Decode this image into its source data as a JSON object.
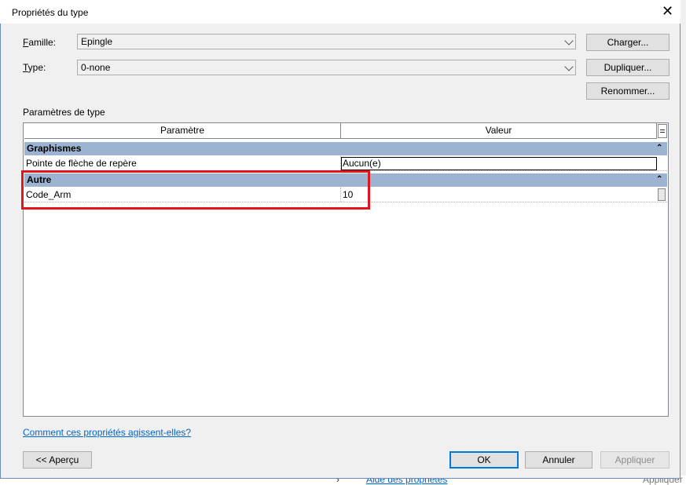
{
  "window": {
    "title": "Propriétés du type",
    "close_label": "✕"
  },
  "famille": {
    "label_prefix": "F",
    "label_rest": "amille:",
    "value": "Epingle"
  },
  "type": {
    "label_prefix": "T",
    "label_rest": "ype:",
    "value": "0-none"
  },
  "buttons": {
    "charger": "Charger...",
    "dupliquer": "Dupliquer...",
    "renommer": "Renommer...",
    "apercu": "<< Aperçu",
    "ok": "OK",
    "annuler": "Annuler",
    "appliquer": "Appliquer"
  },
  "section_label": "Paramètres de type",
  "table": {
    "columns": [
      "Paramètre",
      "Valeur"
    ],
    "collapse_all": "=",
    "groups": [
      {
        "name": "Graphismes",
        "collapse_icon": "⌃",
        "rows": [
          {
            "param": "Pointe de flèche de repère",
            "value": "Aucun(e)"
          }
        ]
      },
      {
        "name": "Autre",
        "collapse_icon": "⌃",
        "rows": [
          {
            "param": "Code_Arm",
            "value": "10"
          }
        ]
      }
    ]
  },
  "help_link": "Comment ces propriétés agissent-elles?",
  "background": {
    "link": "Aide des propriétés",
    "right_text": "Appliquer",
    "chevron": "›"
  },
  "colors": {
    "group_header": "#9db3d2",
    "highlight_box": "#e3151a",
    "link": "#0066cc"
  }
}
